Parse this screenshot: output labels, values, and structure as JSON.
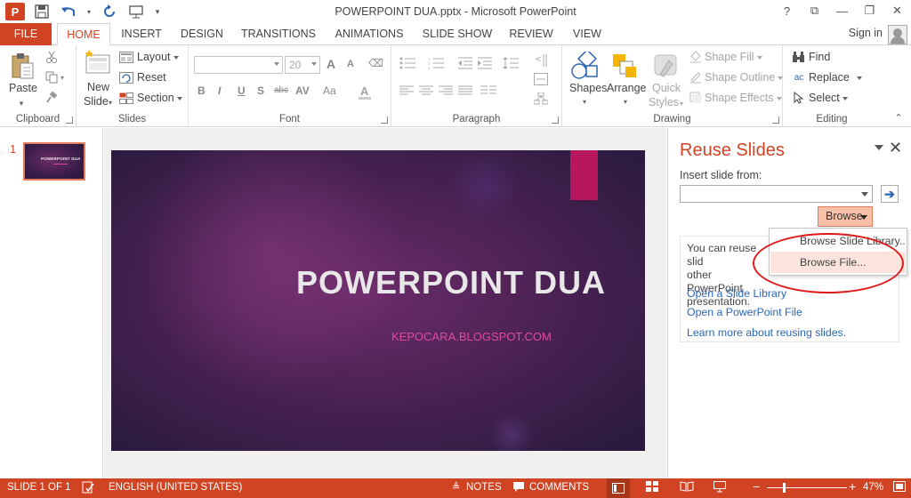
{
  "window": {
    "title": "POWERPOINT DUA.pptx - Microsoft PowerPoint",
    "help": "?",
    "controls": [
      "⧉",
      "—",
      "❐",
      "✕"
    ]
  },
  "tabs": [
    "FILE",
    "HOME",
    "INSERT",
    "DESIGN",
    "TRANSITIONS",
    "ANIMATIONS",
    "SLIDE SHOW",
    "REVIEW",
    "VIEW"
  ],
  "active_tab": "HOME",
  "sign_in": "Sign in",
  "ribbon": {
    "clipboard": {
      "label": "Clipboard",
      "paste": "Paste"
    },
    "slides": {
      "label": "Slides",
      "new_slide_1": "New",
      "new_slide_2": "Slide",
      "layout": "Layout",
      "reset": "Reset",
      "section": "Section"
    },
    "font": {
      "label": "Font",
      "size": "20",
      "bold": "B",
      "italic": "I",
      "underline": "U",
      "shadow": "S",
      "strike": "abc",
      "spacing": "AV",
      "case": "Aa",
      "grow": "A",
      "shrink": "A"
    },
    "paragraph": {
      "label": "Paragraph"
    },
    "drawing": {
      "label": "Drawing",
      "shapes": "Shapes",
      "arrange": "Arrange",
      "quick_1": "Quick",
      "quick_2": "Styles",
      "shape_fill": "Shape Fill",
      "shape_outline": "Shape Outline",
      "shape_effects": "Shape Effects"
    },
    "editing": {
      "label": "Editing",
      "find": "Find",
      "replace": "Replace",
      "select": "Select"
    }
  },
  "thumbnails": [
    {
      "number": "1",
      "title": "POWERPOINT DUA"
    }
  ],
  "slide": {
    "title": "POWERPOINT DUA",
    "subtitle": "KEPOCARA.BLOGSPOT.COM"
  },
  "reuse_pane": {
    "title": "Reuse Slides",
    "insert_label": "Insert slide from:",
    "input_value": "",
    "browse": "Browse",
    "description": "You can reuse slid other PowerPoint presentation.",
    "desc_line1": "You can reuse slid",
    "desc_line2": "other PowerPoint",
    "desc_line3": "presentation.",
    "links": [
      "Open a Slide Library",
      "Open a PowerPoint File",
      "Learn more about reusing slides."
    ]
  },
  "browse_menu": [
    "Browse Slide Library...",
    "Browse File..."
  ],
  "status": {
    "slide": "SLIDE 1 OF 1",
    "language": "ENGLISH (UNITED STATES)",
    "notes": "NOTES",
    "comments": "COMMENTS",
    "zoom": "47%",
    "zoom_fraction": 0.47
  },
  "colors": {
    "accent": "#d04423",
    "link": "#2a66b6",
    "slide_accent": "#b8175e",
    "subtitle": "#e04ba0"
  }
}
